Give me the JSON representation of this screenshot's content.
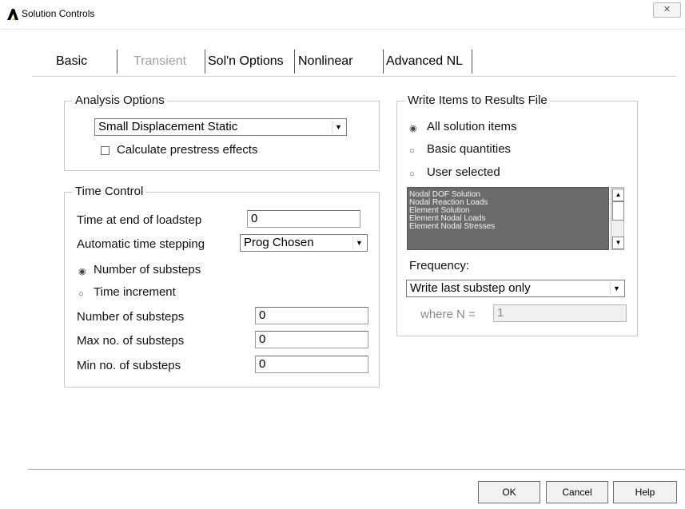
{
  "window": {
    "title": "Solution Controls",
    "close_glyph": "✕"
  },
  "tabs": [
    {
      "label": "Basic",
      "state": "selected"
    },
    {
      "label": "Transient",
      "state": "disabled"
    },
    {
      "label": "Sol'n Options",
      "state": "normal"
    },
    {
      "label": "Nonlinear",
      "state": "normal"
    },
    {
      "label": "Advanced NL",
      "state": "normal"
    }
  ],
  "analysis_options": {
    "title": "Analysis Options",
    "analysis_type": "Small Displacement Static",
    "prestress_label": "Calculate prestress effects",
    "prestress_checked": false
  },
  "time_control": {
    "title": "Time Control",
    "time_end_label": "Time at end of loadstep",
    "time_end_value": "0",
    "auto_step_label": "Automatic time stepping",
    "auto_step_value": "Prog Chosen",
    "radio_substeps_label": "Number of substeps",
    "radio_time_inc_label": "Time increment",
    "selected_radio": "substeps",
    "num_substeps_label": "Number of substeps",
    "num_substeps_value": "0",
    "max_substeps_label": "Max no. of substeps",
    "max_substeps_value": "0",
    "min_substeps_label": "Min no. of substeps",
    "min_substeps_value": "0"
  },
  "write_items": {
    "title": "Write Items to Results File",
    "radio_all": "All solution items",
    "radio_basic": "Basic quantities",
    "radio_user": "User selected",
    "selected_radio": "all",
    "list_items": [
      "Nodal DOF Solution",
      "Nodal Reaction Loads",
      "Element Solution",
      "Element Nodal Loads",
      "Element Nodal Stresses"
    ],
    "frequency_label": "Frequency:",
    "frequency_value": "Write last substep only",
    "where_n_label": "where N =",
    "where_n_value": "1"
  },
  "buttons": {
    "ok": "OK",
    "cancel": "Cancel",
    "help": "Help"
  },
  "colors": {
    "listbox_bg": "#6b6b6b",
    "logo_black": "#000000",
    "logo_yellow": "#f5c400"
  }
}
